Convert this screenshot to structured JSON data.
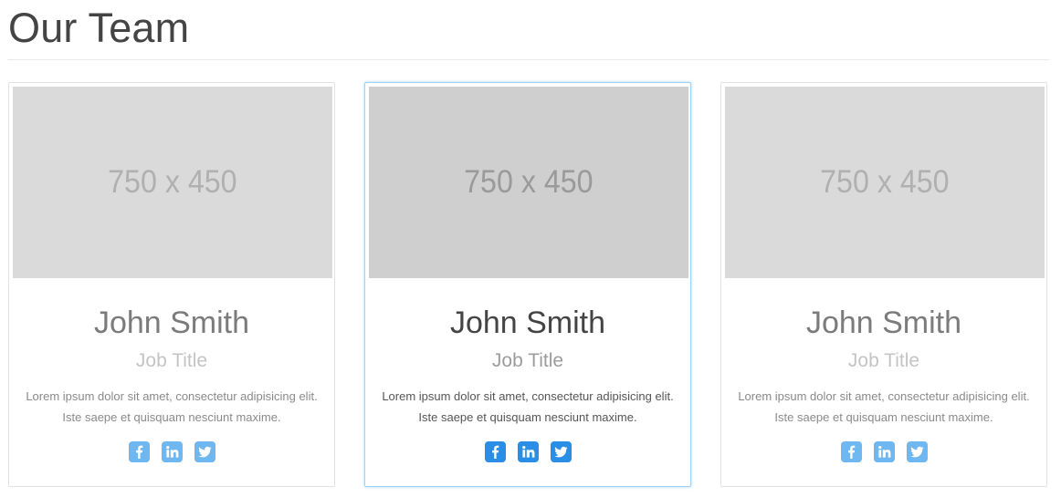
{
  "section": {
    "title": "Our Team"
  },
  "members": [
    {
      "photo_placeholder": "750 x 450",
      "name": "John Smith",
      "job_title": "Job Title",
      "description_line1": "Lorem ipsum dolor sit amet, consectetur adipisicing elit.",
      "description_line2": "Iste saepe et quisquam nesciunt maxime.",
      "social": [
        "facebook-icon",
        "linkedin-icon",
        "twitter-icon"
      ]
    },
    {
      "photo_placeholder": "750 x 450",
      "name": "John Smith",
      "job_title": "Job Title",
      "description_line1": "Lorem ipsum dolor sit amet, consectetur adipisicing elit.",
      "description_line2": "Iste saepe et quisquam nesciunt maxime.",
      "social": [
        "facebook-icon",
        "linkedin-icon",
        "twitter-icon"
      ],
      "state": "hovered"
    },
    {
      "photo_placeholder": "750 x 450",
      "name": "John Smith",
      "job_title": "Job Title",
      "description_line1": "Lorem ipsum dolor sit amet, consectetur adipisicing elit.",
      "description_line2": "Iste saepe et quisquam nesciunt maxime.",
      "social": [
        "facebook-icon",
        "linkedin-icon",
        "twitter-icon"
      ]
    }
  ],
  "colors": {
    "accent": "#2a8ee6",
    "accent_muted": "#6fb7f0",
    "hover_border": "#9fd4f2",
    "placeholder_bg": "#dadada"
  }
}
